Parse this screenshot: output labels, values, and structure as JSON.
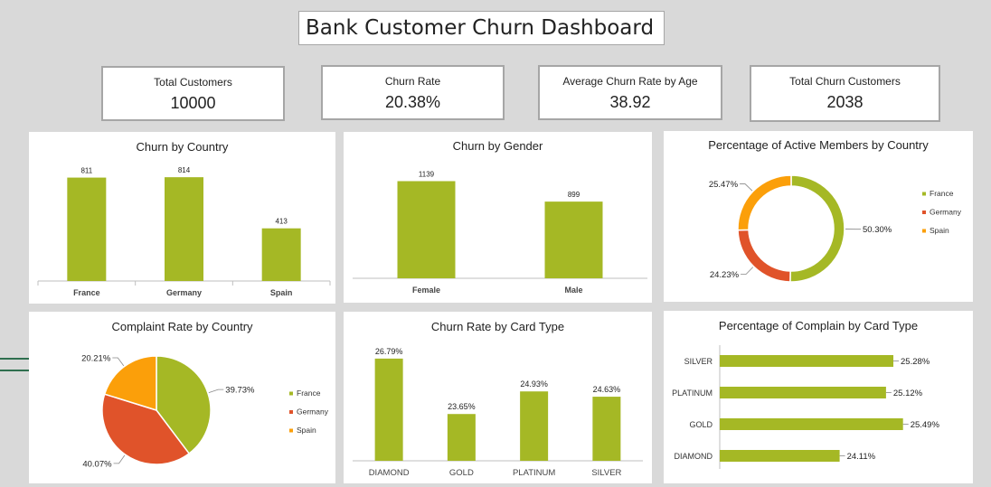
{
  "dashboard_title": "Bank Customer Churn Dashboard",
  "kpis": [
    {
      "label": "Total Customers",
      "value": "10000"
    },
    {
      "label": "Churn Rate",
      "value": "20.38%"
    },
    {
      "label": "Average Churn Rate by Age",
      "value": "38.92"
    },
    {
      "label": "Total Churn Customers",
      "value": "2038"
    }
  ],
  "colors": {
    "green": "#a5b825",
    "red": "#e0532a",
    "orange": "#fb9f0a",
    "axis": "#bfbfbf"
  },
  "chart_data": [
    {
      "id": "churn-country",
      "type": "bar",
      "title": "Churn by Country",
      "categories": [
        "France",
        "Germany",
        "Spain"
      ],
      "values": [
        811,
        814,
        413
      ],
      "data_labels": [
        "811",
        "814",
        "413"
      ],
      "ylim": [
        0,
        900
      ],
      "grid": false
    },
    {
      "id": "churn-gender",
      "type": "bar",
      "title": "Churn by Gender",
      "categories": [
        "Female",
        "Male"
      ],
      "values": [
        1139,
        899
      ],
      "data_labels": [
        "1139",
        "899"
      ],
      "ylim": [
        0,
        1250
      ],
      "grid": false
    },
    {
      "id": "active-members",
      "type": "pie",
      "subtype": "doughnut",
      "title": "Percentage of Active Members by Country",
      "categories": [
        "France",
        "Germany",
        "Spain"
      ],
      "values": [
        50.3,
        24.23,
        25.47
      ],
      "data_labels": [
        "50.30%",
        "24.23%",
        "25.47%"
      ],
      "legend": "right"
    },
    {
      "id": "complaint-country",
      "type": "pie",
      "title": "Complaint Rate by Country",
      "categories": [
        "France",
        "Germany",
        "Spain"
      ],
      "values": [
        39.73,
        40.07,
        20.21
      ],
      "data_labels": [
        "39.73%",
        "40.07%",
        "20.21%"
      ],
      "legend": "right"
    },
    {
      "id": "churn-card",
      "type": "bar",
      "title": "Churn Rate by Card Type",
      "categories": [
        "DIAMOND",
        "GOLD",
        "PLATINUM",
        "SILVER"
      ],
      "values": [
        26.79,
        23.65,
        24.93,
        24.63
      ],
      "data_labels": [
        "26.79%",
        "23.65%",
        "24.93%",
        "24.63%"
      ],
      "ylim": [
        21,
        27.5
      ],
      "grid": false
    },
    {
      "id": "complain-card",
      "type": "bar",
      "orientation": "horizontal",
      "title": "Percentage of Complain by Card Type",
      "categories": [
        "SILVER",
        "PLATINUM",
        "GOLD",
        "DIAMOND"
      ],
      "values": [
        25.28,
        25.12,
        25.49,
        24.11
      ],
      "data_labels": [
        "25.28%",
        "25.12%",
        "25.49%",
        "24.11%"
      ],
      "xlim": [
        21.5,
        26.5
      ],
      "grid": false
    }
  ]
}
